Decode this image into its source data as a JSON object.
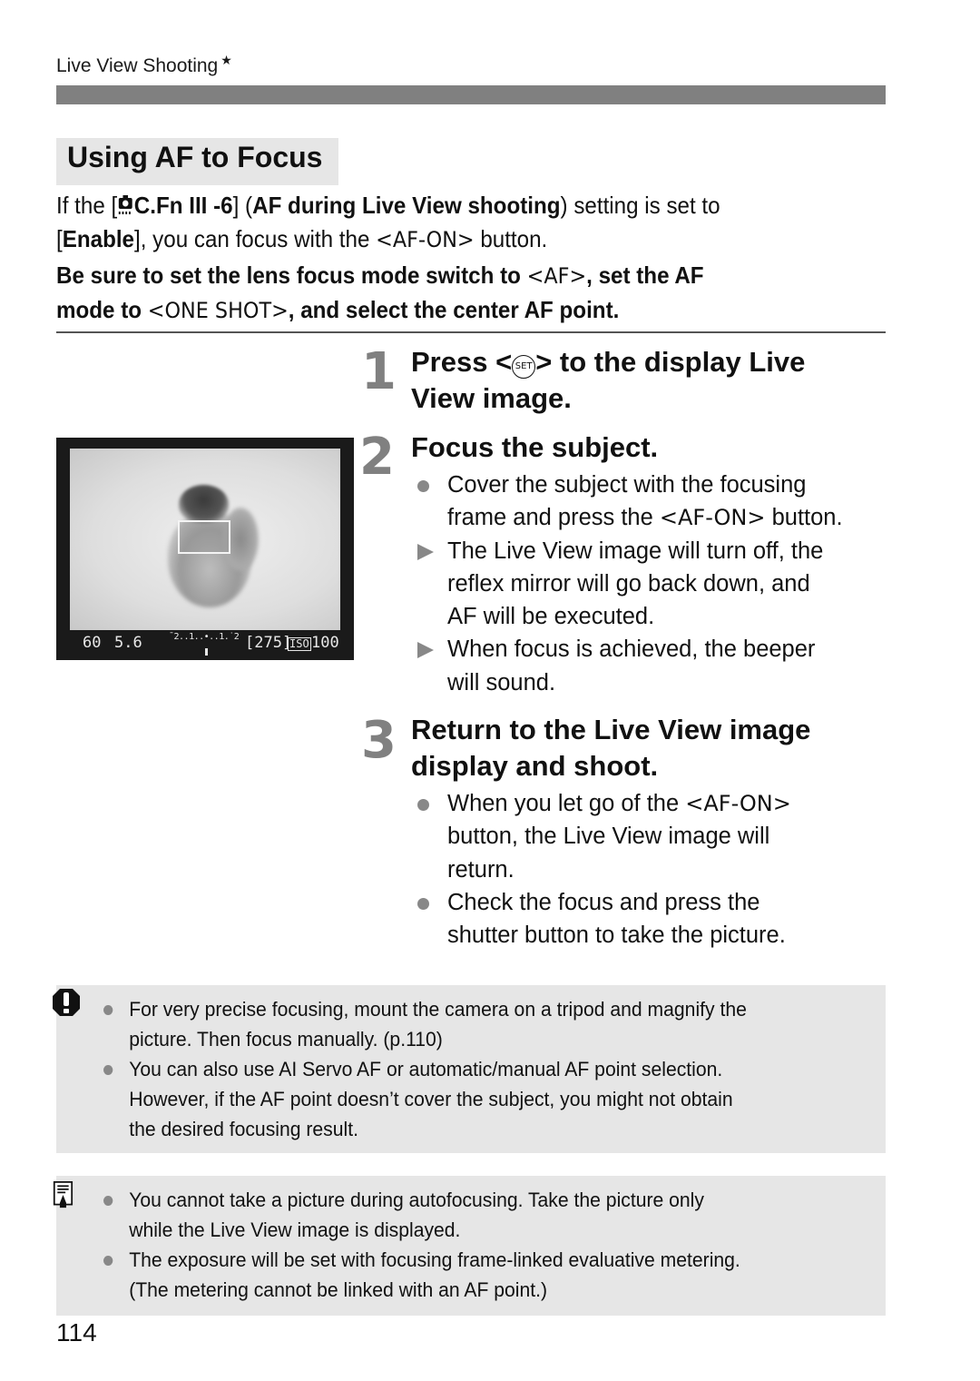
{
  "header": {
    "section_label": "Live View Shooting",
    "star": "★"
  },
  "section_title": "Using AF to Focus",
  "intro": {
    "p1_a": "If the [",
    "p1_icon": "camera-menu-icon",
    "p1_b": "C.Fn III -6",
    "p1_c": "] (",
    "p1_d": "AF during Live View shooting",
    "p1_e": ") setting is set to",
    "p1_f": "[",
    "p1_g": "Enable",
    "p1_h": "], you can focus with the ",
    "p1_key": "<AF-ON>",
    "p1_i": " button.",
    "note_a": "Be sure to set the lens focus mode switch to ",
    "note_key1": "<AF>",
    "note_b": ", set the AF",
    "note_c": "mode to ",
    "note_key2": "<ONE SHOT>",
    "note_d": ", and select the center AF point."
  },
  "screen": {
    "shutter": "60",
    "aperture": "5.6",
    "meter": "¯2..1..•..1.˙2",
    "shots": "[275]",
    "iso_label": "ISO",
    "iso_value": "100"
  },
  "steps": [
    {
      "number": "1",
      "title_a": "Press <",
      "title_key": "SET",
      "title_b": "> to the display Live",
      "title_c": "View image."
    },
    {
      "number": "2",
      "title": "Focus the subject.",
      "bullets": [
        {
          "type": "dot",
          "a": "Cover the subject with the focusing",
          "b": "frame and press the ",
          "key": "<AF-ON>",
          "c": " button."
        },
        {
          "type": "arrow",
          "lines": [
            "The Live View image will turn off, the",
            "reflex mirror will go back down, and",
            "AF will be executed."
          ]
        },
        {
          "type": "arrow",
          "lines": [
            "When focus is achieved, the beeper",
            "will sound."
          ]
        }
      ]
    },
    {
      "number": "3",
      "title_a": "Return to the Live View image",
      "title_b": "display and shoot.",
      "bullets": [
        {
          "type": "dot",
          "a": "When you let go of the ",
          "key": "<AF-ON>",
          "b": "button, the Live View image will",
          "c": "return."
        },
        {
          "type": "dot",
          "lines": [
            "Check the focus and press the",
            "shutter button to take the picture."
          ]
        }
      ]
    }
  ],
  "caution": {
    "icon": "caution-icon",
    "items": [
      {
        "lines": [
          "For very precise focusing, mount the camera on a tripod and magnify the",
          "picture. Then focus manually. (p.110)"
        ]
      },
      {
        "lines": [
          "You can also use AI Servo AF or automatic/manual AF point selection.",
          "However, if the AF point doesn’t cover the subject, you might not obtain",
          "the desired focusing result."
        ]
      }
    ]
  },
  "memo": {
    "icon": "memo-icon",
    "items": [
      {
        "lines": [
          "You cannot take a picture during autofocusing. Take the picture only",
          "while the Live View image is displayed."
        ]
      },
      {
        "lines": [
          "The exposure will be set with focusing frame-linked evaluative metering.",
          "(The metering cannot be linked with an AF point.)"
        ]
      }
    ]
  },
  "page_number": "114"
}
